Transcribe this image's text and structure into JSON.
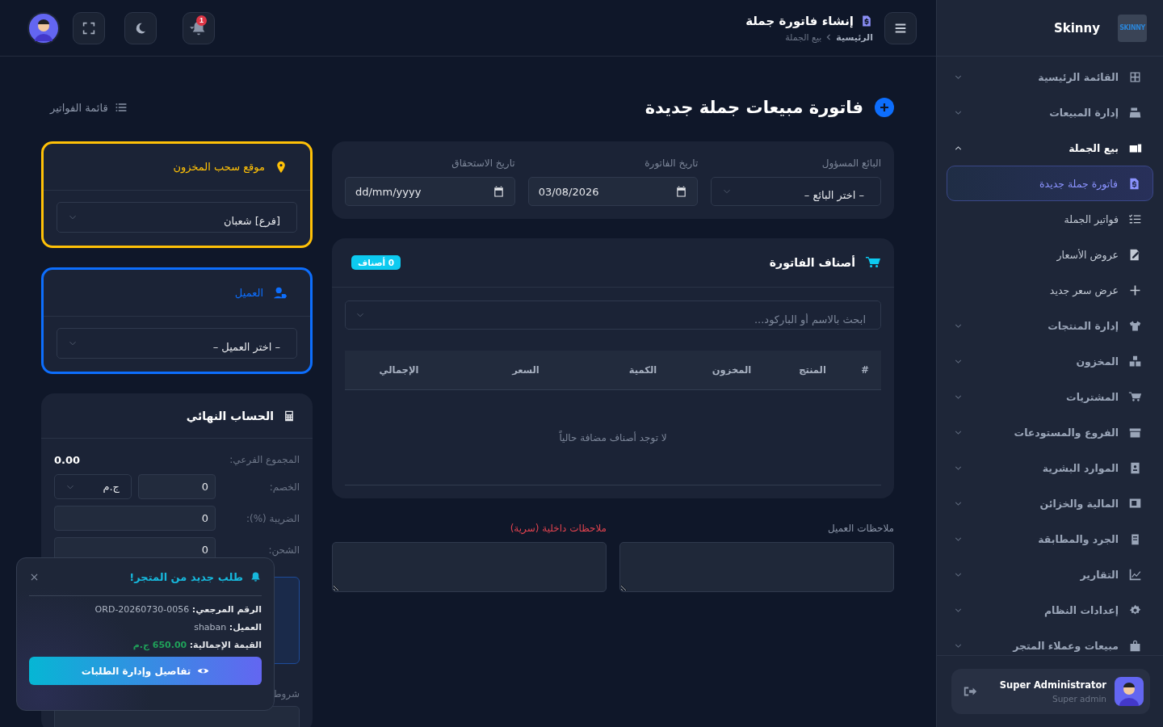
{
  "header": {
    "title": "إنشاء فاتورة جملة",
    "breadcrumb": [
      "الرئيسية",
      "بيع الجملة"
    ],
    "notification_count": "1"
  },
  "page": {
    "title": "فاتورة مبيعات جملة جديدة",
    "list_link": "قائمة الفواتير"
  },
  "filters": [
    {
      "kind": "select",
      "label": "البائع المسؤول",
      "value": "– اختر البائع –"
    },
    {
      "kind": "date",
      "label": "تاريخ الفاتورة",
      "value": "03/08/2026"
    },
    {
      "kind": "date",
      "label": "تاريخ الاستحقاق",
      "value": "dd/mm/yyyy"
    }
  ],
  "items": {
    "title": "أصناف الفاتورة",
    "count_badge": "0 أصناف",
    "search_placeholder": "ابحث بالاسم أو الباركود...",
    "columns": [
      "#",
      "المنتج",
      "المخزون",
      "الكمية",
      "السعر",
      "الإجمالي"
    ],
    "empty_text": "لا توجد أصناف مضافة حالياً"
  },
  "notes": [
    {
      "kind": "public",
      "label": "ملاحظات العميل"
    },
    {
      "kind": "private",
      "label": "ملاحظات داخلية (سرية)"
    }
  ],
  "selector_cards": [
    {
      "kind": "location",
      "title": "موقع سحب المخزون",
      "value": "[فرع] شعبان",
      "color": "#ffc107"
    },
    {
      "kind": "customer",
      "title": "العميل",
      "value": "– اختر العميل –",
      "color": "#0d6efd"
    }
  ],
  "summary": {
    "title": "الحساب النهائي",
    "rows": [
      {
        "kind": "value",
        "label": "المجموع الفرعي:",
        "value": "0.00"
      },
      {
        "kind": "discount",
        "label": "الخصم:",
        "value": "0",
        "unit": "ج.م"
      },
      {
        "kind": "input",
        "label": "الضريبة (%):",
        "value": "0"
      },
      {
        "kind": "input",
        "label": "الشحن:",
        "value": "0"
      }
    ],
    "terms_label": "شروط"
  },
  "toast": {
    "title": "طلب جديد من المتجر!",
    "lines": [
      {
        "kind": "text",
        "label": "الرقم المرجعي:",
        "value": "ORD-20260730-0056"
      },
      {
        "kind": "text",
        "label": "العميل:",
        "value": "shaban"
      },
      {
        "kind": "amount",
        "label": "القيمة الإجمالية:",
        "value": "650.00 ج.م"
      }
    ],
    "button": "تفاصيل وإدارة الطلبات"
  },
  "sidebar": {
    "brand": "Skinny",
    "logo": "SKINNY",
    "items": [
      {
        "label": "القائمة الرئيسية",
        "expanded": false
      },
      {
        "label": "إدارة المبيعات",
        "expanded": false
      },
      {
        "label": "بيع الجملة",
        "expanded": true,
        "children": [
          {
            "label": "فاتورة جملة جديدة",
            "selected": true
          },
          {
            "label": "فواتير الجملة",
            "selected": false
          },
          {
            "label": "عروض الأسعار",
            "selected": false
          },
          {
            "label": "عرض سعر جديد",
            "selected": false
          }
        ]
      },
      {
        "label": "إدارة المنتجات",
        "expanded": false
      },
      {
        "label": "المخزون",
        "expanded": false
      },
      {
        "label": "المشتريات",
        "expanded": false
      },
      {
        "label": "الفروع والمستودعات",
        "expanded": false
      },
      {
        "label": "الموارد البشرية",
        "expanded": false
      },
      {
        "label": "المالية والخزائن",
        "expanded": false
      },
      {
        "label": "الجرد والمطابقة",
        "expanded": false
      },
      {
        "label": "التقارير",
        "expanded": false
      },
      {
        "label": "إعدادات النظام",
        "expanded": false
      },
      {
        "label": "مبيعات وعملاء المتجر",
        "expanded": false
      }
    ],
    "user": {
      "name": "Super Administrator",
      "role": "Super admin"
    }
  }
}
